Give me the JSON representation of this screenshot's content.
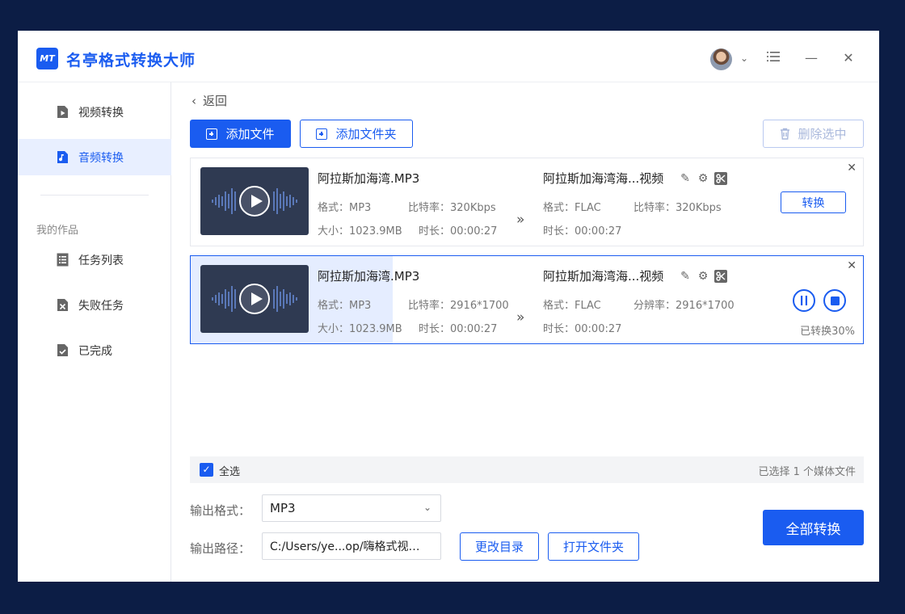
{
  "app": {
    "logo_text": "MT",
    "title": "名亭格式转换大师"
  },
  "titlebar": {
    "menu_icon": "menu-icon",
    "minimize_icon": "minimize-icon",
    "close_icon": "close-icon"
  },
  "sidebar": {
    "items": [
      {
        "label": "视频转换",
        "icon": "video-file-icon"
      },
      {
        "label": "音频转换",
        "icon": "audio-file-icon",
        "active": true
      }
    ],
    "section_label": "我的作品",
    "works": [
      {
        "label": "任务列表",
        "icon": "list-icon"
      },
      {
        "label": "失败任务",
        "icon": "failed-icon"
      },
      {
        "label": "已完成",
        "icon": "done-icon"
      }
    ]
  },
  "toolbar": {
    "back_label": "返回",
    "add_file_label": "添加文件",
    "add_folder_label": "添加文件夹",
    "delete_selected_label": "删除选中"
  },
  "tasks": [
    {
      "src_name": "阿拉斯加海湾.MP3",
      "src_format": "格式：MP3",
      "src_bitrate": "比特率：320Kbps",
      "src_size": "大小：1023.9MB",
      "src_duration": "时长：00:00:27",
      "out_name": "阿拉斯加海湾海...视频",
      "out_format": "格式：FLAC",
      "out_bitrate": "比特率：320Kbps",
      "out_duration": "时长：00:00:27",
      "convert_label": "转换"
    },
    {
      "src_name": "阿拉斯加海湾.MP3",
      "src_format": "格式：MP3",
      "src_bitrate": "比特率：2916*1700",
      "src_size": "大小：1023.9MB",
      "src_duration": "时长：00:00:27",
      "out_name": "阿拉斯加海湾海...视频",
      "out_format": "格式：FLAC",
      "out_resolution": "分辨率：2916*1700",
      "out_duration": "时长：00:00:27",
      "progress": 0.3,
      "status": "已转换30%"
    }
  ],
  "selection": {
    "select_all_label": "全选",
    "checked": true,
    "summary": "已选择 1 个媒体文件"
  },
  "output": {
    "format_label": "输出格式：",
    "format_value": "MP3",
    "path_label": "输出路径：",
    "path_value": "C:/Users/ye...op/嗨格式视…",
    "change_dir_label": "更改目录",
    "open_folder_label": "打开文件夹",
    "convert_all_label": "全部转换"
  },
  "colors": {
    "accent": "#1a5cf0",
    "background": "#0c1d45",
    "progress_fill": "#e5edff"
  }
}
